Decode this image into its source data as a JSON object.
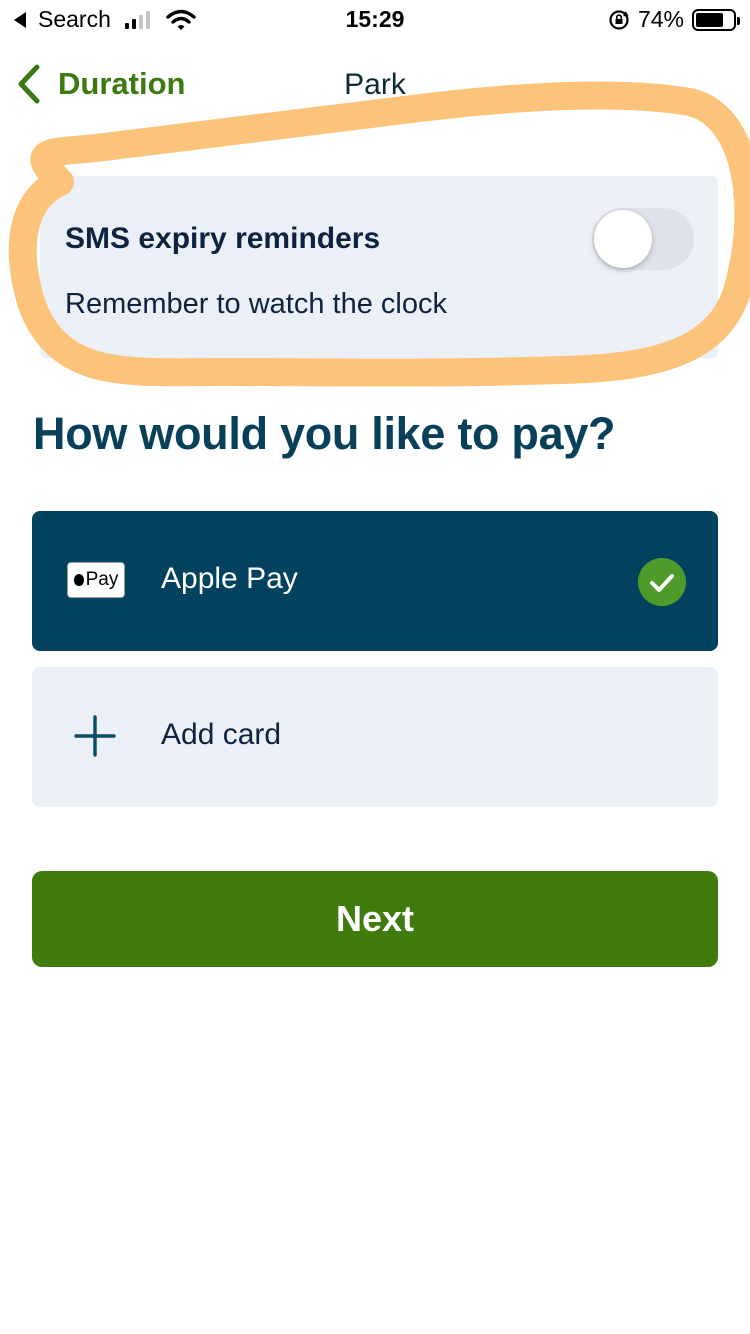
{
  "status_bar": {
    "back_app": "Search",
    "time": "15:29",
    "battery": "74%",
    "battery_level": 0.74,
    "icons": [
      "back-triangle-icon",
      "signal-icon",
      "wifi-icon",
      "orientation-lock-icon",
      "battery-icon"
    ]
  },
  "nav": {
    "back_label": "Duration",
    "title": "Park",
    "back_icon": "chevron-left-icon"
  },
  "sms": {
    "title": "SMS expiry reminders",
    "subtitle": "Remember to watch the clock",
    "toggle_on": false
  },
  "payment": {
    "heading": "How would you like to pay?",
    "options": [
      {
        "label": "Apple Pay",
        "badge": "Pay",
        "selected": true,
        "icon": "apple-pay-icon"
      },
      {
        "label": "Add card",
        "selected": false,
        "icon": "plus-icon"
      }
    ]
  },
  "next_label": "Next",
  "colors": {
    "brand_green": "#3f7b0d",
    "navy": "#02425e",
    "card_bg": "#ebeff6",
    "check_green": "#4e9a2a",
    "highlight": "#fcc47a"
  }
}
